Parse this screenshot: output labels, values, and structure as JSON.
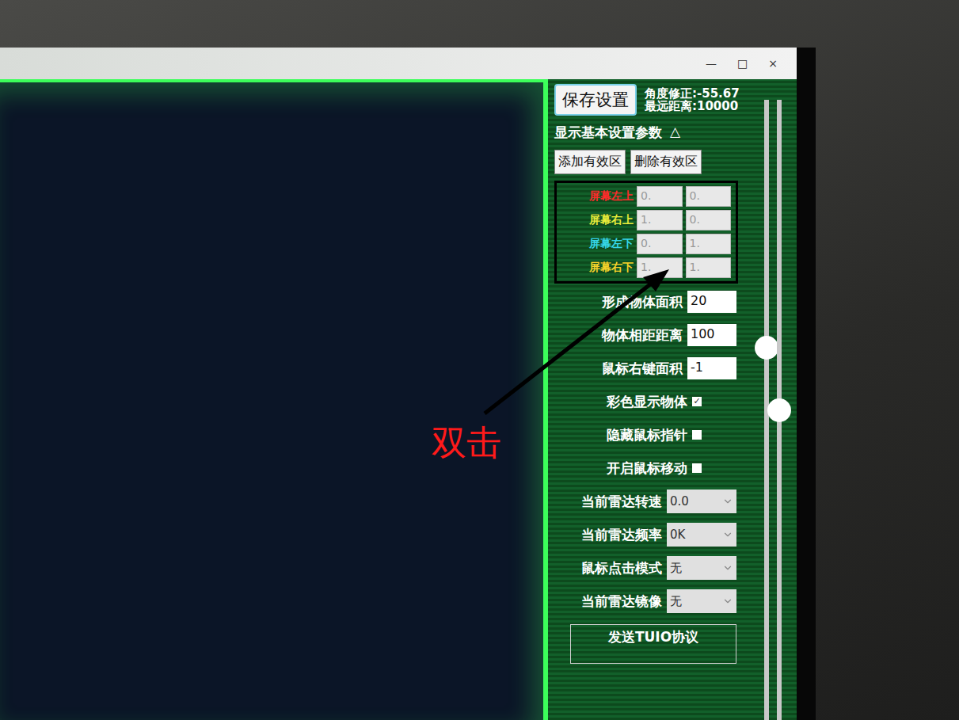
{
  "window": {
    "controls": [
      "—",
      "□",
      "×"
    ]
  },
  "header": {
    "save_button": "保存设置",
    "angle": "角度修正:-55.67",
    "max_distance": "最远距离:10000"
  },
  "section": {
    "title": "显示基本设置参数",
    "toggle": "△"
  },
  "zone_buttons": [
    "添加有效区",
    "删除有效区"
  ],
  "corners": [
    {
      "label": "屏幕左上",
      "x": "0.",
      "y": "0.",
      "color": "#ff2a2a"
    },
    {
      "label": "屏幕右上",
      "x": "1.",
      "y": "0.",
      "color": "#e8ec3a"
    },
    {
      "label": "屏幕左下",
      "x": "0.",
      "y": "1.",
      "color": "#35d6e8"
    },
    {
      "label": "屏幕右下",
      "x": "1.",
      "y": "1.",
      "color": "#f5d22a"
    }
  ],
  "fields": [
    {
      "label": "形成物体面积",
      "value": "20"
    },
    {
      "label": "物体相距距离",
      "value": "100"
    },
    {
      "label": "鼠标右键面积",
      "value": "-1"
    }
  ],
  "checkboxes": [
    {
      "label": "彩色显示物体",
      "checked": true
    },
    {
      "label": "隐藏鼠标指针",
      "checked": false
    },
    {
      "label": "开启鼠标移动",
      "checked": false
    }
  ],
  "selects": [
    {
      "label": "当前雷达转速",
      "value": "0.0"
    },
    {
      "label": "当前雷达频率",
      "value": "0K"
    },
    {
      "label": "鼠标点击模式",
      "value": "无"
    },
    {
      "label": "当前雷达镜像",
      "value": "无"
    }
  ],
  "tuio_group": {
    "title": "发送TUIO协议"
  },
  "sliders": [
    {
      "level": 0.6
    },
    {
      "level": 0.5
    }
  ],
  "annotation": {
    "label": "双击"
  }
}
